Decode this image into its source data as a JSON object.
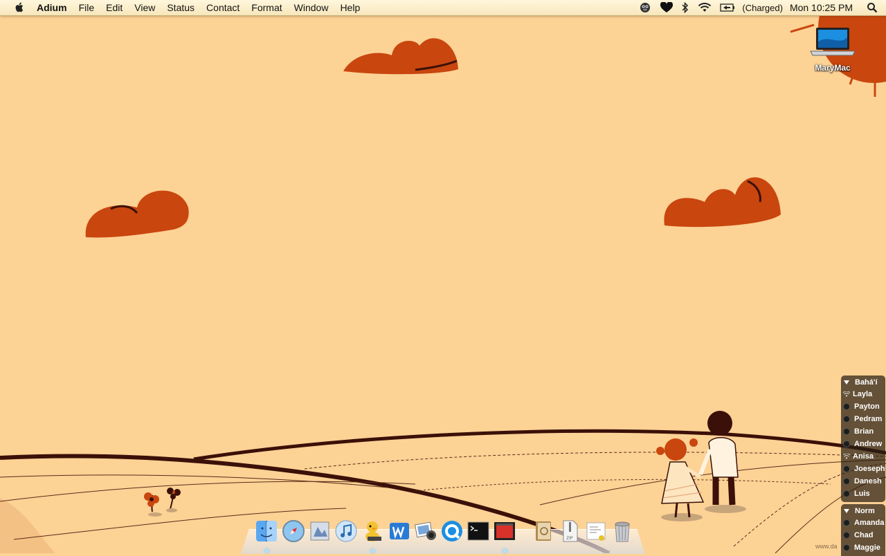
{
  "menubar": {
    "app_name": "Adium",
    "menus": [
      "File",
      "Edit",
      "View",
      "Status",
      "Contact",
      "Format",
      "Window",
      "Help"
    ],
    "status_icons": [
      "adium-duck-icon",
      "heart-icon",
      "bluetooth-icon",
      "wifi-icon",
      "battery-icon",
      "spotlight-icon"
    ],
    "battery_text": "(Charged)",
    "clock": "Mon 10:25 PM"
  },
  "desktop": {
    "icon_label": "MaryMac",
    "icon": "laptop-icon"
  },
  "contacts": {
    "groups": [
      {
        "name": "Bahá'í",
        "members": [
          {
            "name": "Layla",
            "status": "wifi"
          },
          {
            "name": "Payton",
            "status": "dot"
          },
          {
            "name": "Pedram",
            "status": "dot"
          },
          {
            "name": "Brian",
            "status": "dot"
          },
          {
            "name": "Andrew",
            "status": "dot"
          },
          {
            "name": "Anisa",
            "status": "wifi"
          },
          {
            "name": "Joeseph",
            "status": "dot"
          },
          {
            "name": "Danesh",
            "status": "dot"
          },
          {
            "name": "Luis",
            "status": "dot"
          }
        ]
      },
      {
        "name": "Norm",
        "members": [
          {
            "name": "Amanda",
            "status": "dot"
          },
          {
            "name": "Chad",
            "status": "dot"
          },
          {
            "name": "Maggie",
            "status": "dot"
          }
        ]
      }
    ]
  },
  "dock": {
    "items": [
      "finder-icon",
      "safari-icon",
      "preview-icon",
      "itunes-icon",
      "adium-icon",
      "word-icon",
      "iphoto-icon",
      "quicktime-icon",
      "terminal-icon",
      "photo-booth-icon",
      "address-book-icon",
      "zip-archive-icon",
      "document-stack-icon",
      "trash-icon"
    ]
  },
  "watermark": "www.da",
  "colors": {
    "wallpaper": "#fdd295",
    "cloud": "#c9460f",
    "line": "#3b1008"
  }
}
